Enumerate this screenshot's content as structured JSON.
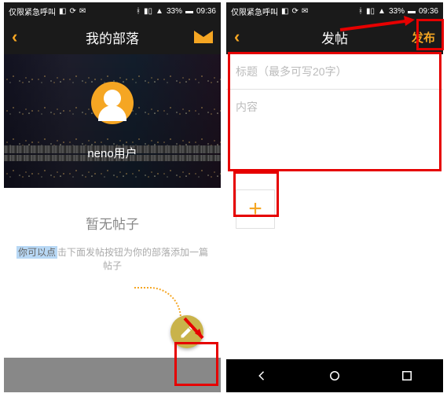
{
  "status": {
    "carrier": "仅限紧急呼叫",
    "battery": "33%",
    "time": "09:36"
  },
  "left": {
    "header_title": "我的部落",
    "username": "neno用户",
    "empty_title": "暂无帖子",
    "empty_sub_highlight": "你可以点",
    "empty_sub_rest": "击下面发帖按钮为你的部落添加一篇帖子"
  },
  "right": {
    "header_title": "发帖",
    "publish_label": "发布",
    "title_placeholder": "标题（最多可写20字）",
    "content_placeholder": "内容"
  },
  "colors": {
    "accent": "#f5a623",
    "red": "#e60000"
  }
}
